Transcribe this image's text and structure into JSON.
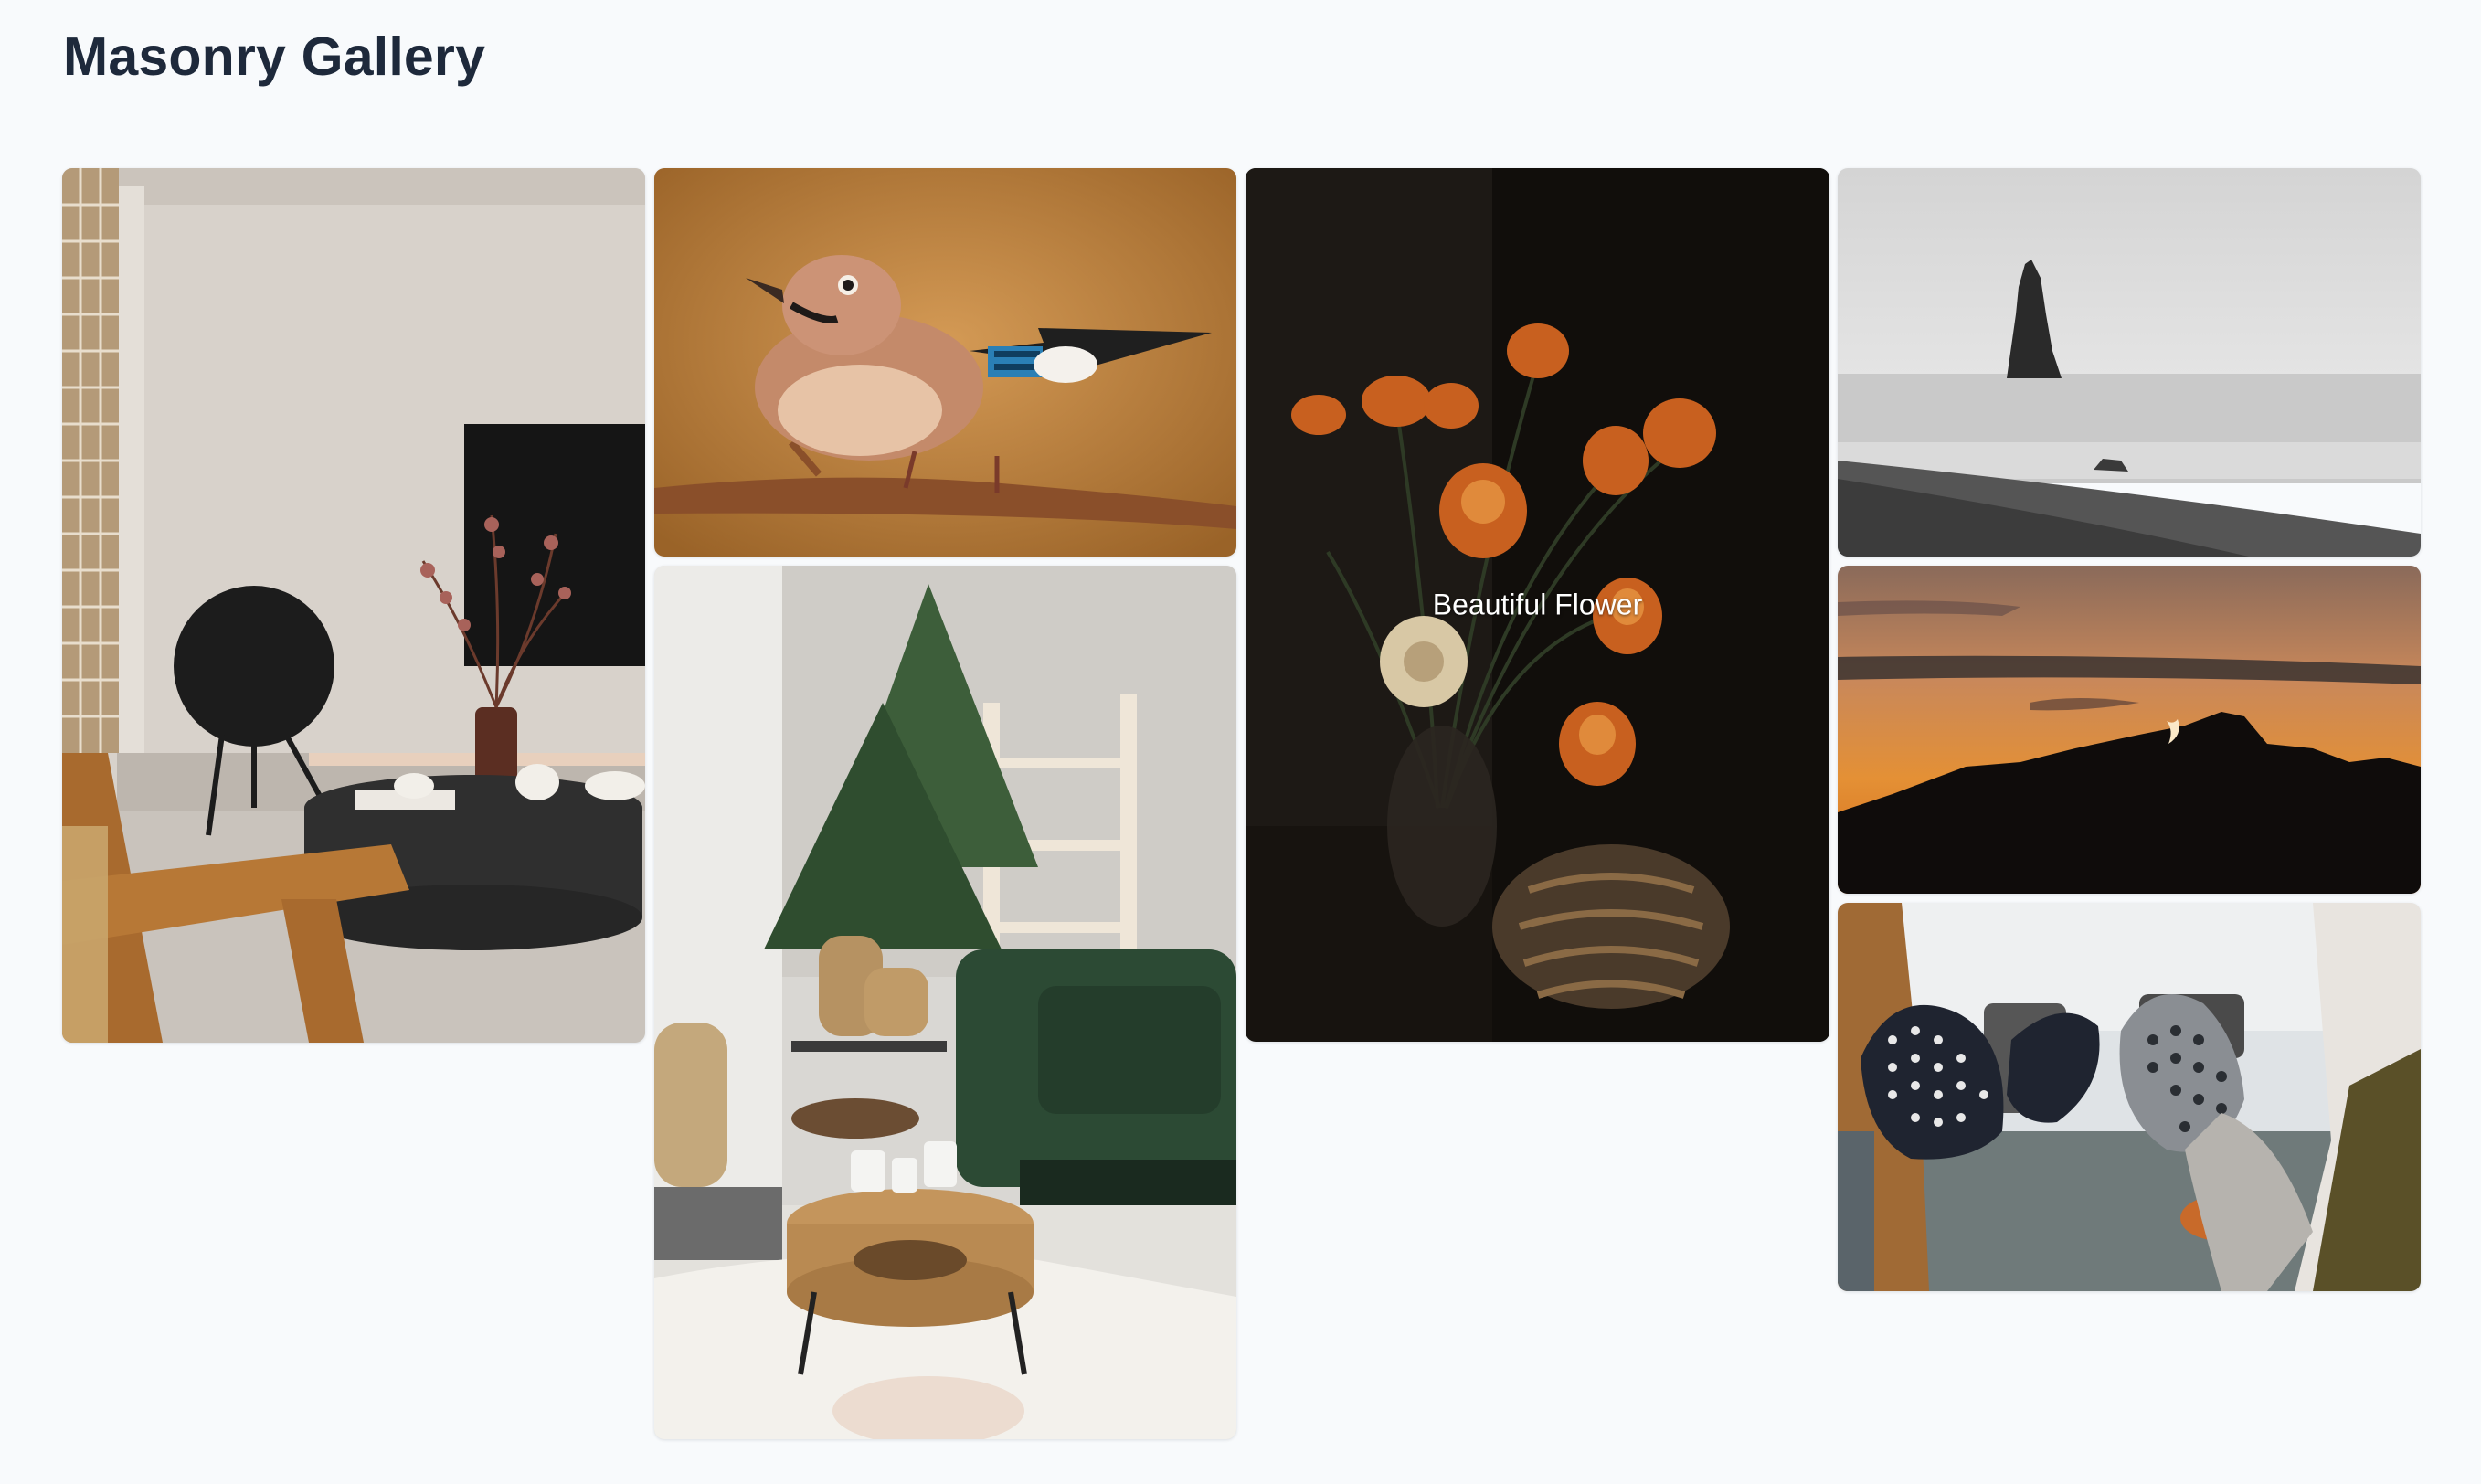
{
  "page": {
    "title": "Masonry Gallery"
  },
  "gallery": {
    "items": [
      {
        "subject": "minimal-living-room-photo",
        "caption": ""
      },
      {
        "subject": "bird-on-branch-photo",
        "caption": ""
      },
      {
        "subject": "cozy-winter-interior-photo",
        "caption": ""
      },
      {
        "subject": "dark-flowers-photo",
        "caption": "Beautiful Flower"
      },
      {
        "subject": "sea-stack-foggy-beach-photo",
        "caption": ""
      },
      {
        "subject": "mountain-sunset-moon-photo",
        "caption": ""
      },
      {
        "subject": "mittens-holding-mugs-photo",
        "caption": ""
      }
    ]
  },
  "colors": {
    "background": "#f8fafc",
    "title": "#1e293b"
  }
}
